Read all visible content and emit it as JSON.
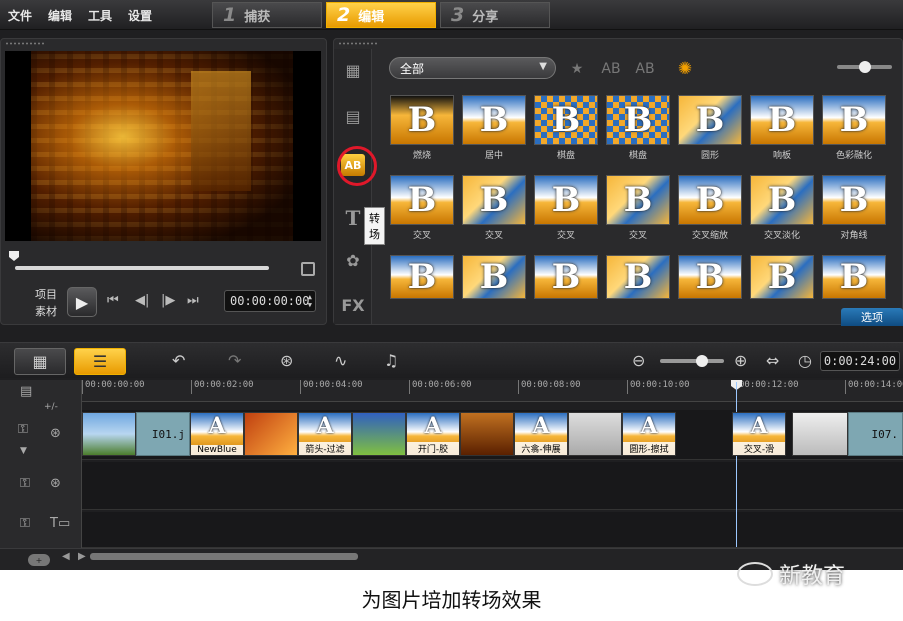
{
  "menu": [
    "文件",
    "编辑",
    "工具",
    "设置"
  ],
  "steps": [
    {
      "num": "1",
      "label": "捕获"
    },
    {
      "num": "2",
      "label": "编辑"
    },
    {
      "num": "3",
      "label": "分享"
    }
  ],
  "player": {
    "mode_project": "项目",
    "mode_clip": "素材",
    "timecode": "00:00:00:00"
  },
  "library": {
    "category": "全部",
    "tooltip": "转场",
    "side_fx": "FX",
    "options": "选项",
    "thumb_letter": "B",
    "transitions_row1": [
      "燃烧",
      "居中",
      "棋盘",
      "棋盘",
      "圆形",
      "响板",
      "色彩融化"
    ],
    "transitions_row2": [
      "交叉",
      "交叉",
      "交叉",
      "交叉",
      "交叉缩放",
      "交叉淡化",
      "对角线"
    ]
  },
  "timeline": {
    "duration": "0:00:24:00",
    "ruler": [
      "00:00:00:00",
      "00:00:02:00",
      "00:00:04:00",
      "00:00:06:00",
      "00:00:08:00",
      "00:00:10:00",
      "00:00:12:00",
      "00:00:14:00"
    ],
    "clip_first": "I01.j",
    "clip_last": "I07.",
    "transition_letter": "A",
    "transition_captions": [
      "NewBlue",
      "箭头-过滤",
      "开门-胶",
      "六翕-伸展",
      "圆形-擦拭",
      "交叉-滑"
    ],
    "add_track": "+/-"
  },
  "caption": "为图片培加转场效果",
  "watermark": "新教育"
}
